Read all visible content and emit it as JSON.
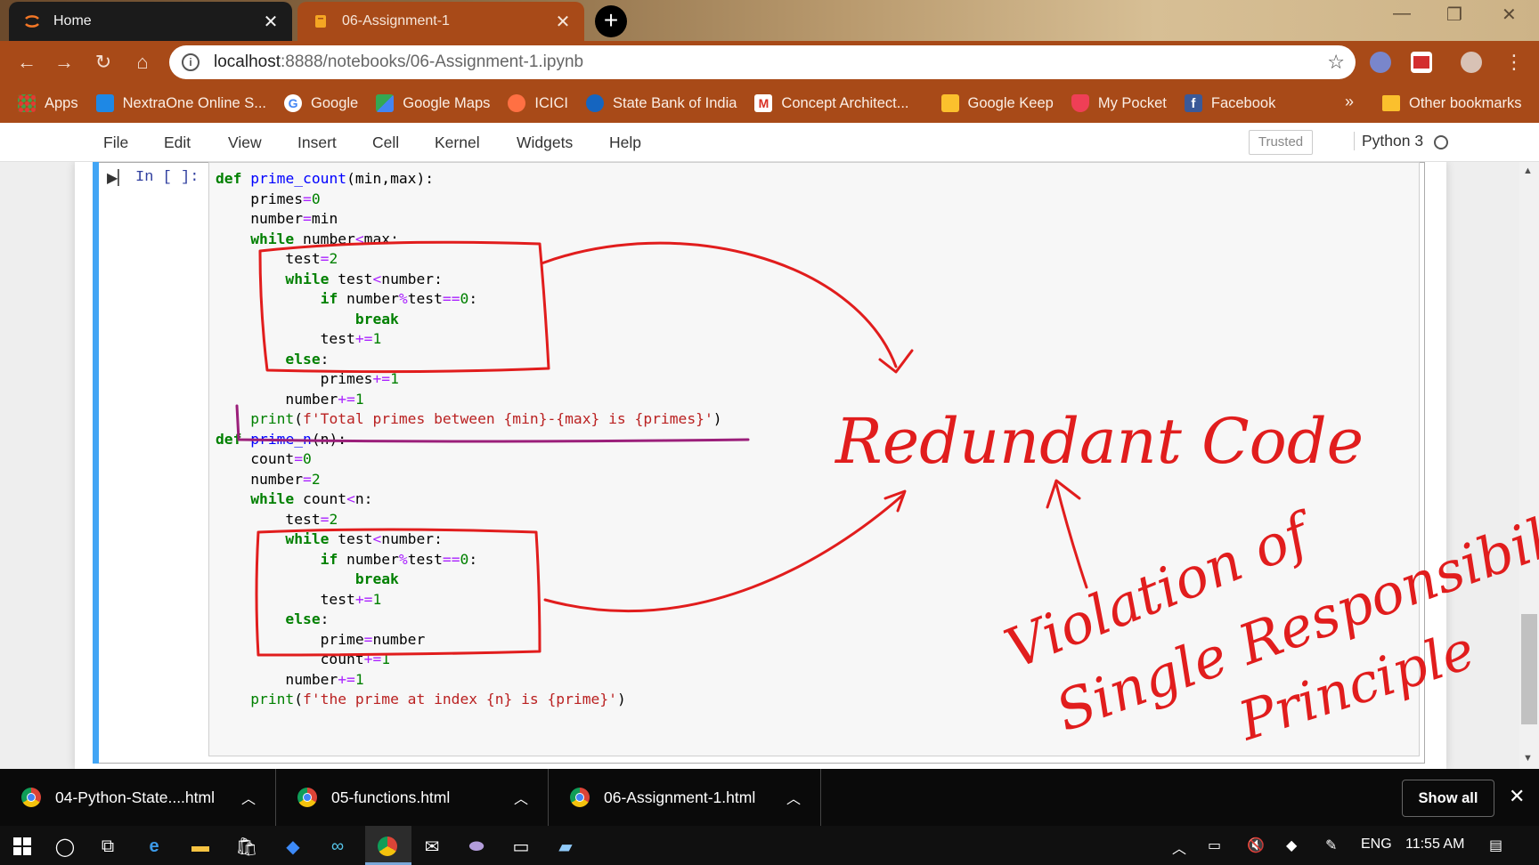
{
  "browser": {
    "tabs": [
      {
        "title": "Home"
      },
      {
        "title": "06-Assignment-1"
      }
    ],
    "url_host": "localhost",
    "url_path": ":8888/notebooks/06-Assignment-1.ipynb",
    "bookmarks": [
      {
        "label": "Apps",
        "icon": "apps-grid-icon",
        "color": "#e53935"
      },
      {
        "label": "NextraOne Online S...",
        "icon": "nextraone-icon",
        "color": "#1e88e5"
      },
      {
        "label": "Google",
        "icon": "google-icon",
        "color": "#ffffff"
      },
      {
        "label": "Google Maps",
        "icon": "google-maps-icon",
        "color": "#34a853"
      },
      {
        "label": "ICICI",
        "icon": "icici-icon",
        "color": "#ff7043"
      },
      {
        "label": "State Bank of India",
        "icon": "sbi-icon",
        "color": "#1565c0"
      },
      {
        "label": "Concept Architect...",
        "icon": "gmail-icon",
        "color": "#ffffff"
      },
      {
        "label": "Google Keep",
        "icon": "google-keep-icon",
        "color": "#fbc02d"
      },
      {
        "label": "My Pocket",
        "icon": "pocket-icon",
        "color": "#ef3f56"
      },
      {
        "label": "Facebook",
        "icon": "facebook-icon",
        "color": "#3b5998"
      }
    ],
    "bookmarks_more": "»",
    "other_bookmarks": "Other bookmarks"
  },
  "jupyter": {
    "menu": [
      "File",
      "Edit",
      "View",
      "Insert",
      "Cell",
      "Kernel",
      "Widgets",
      "Help"
    ],
    "trusted": "Trusted",
    "kernel": "Python 3"
  },
  "cell": {
    "prompt": "In [ ]:",
    "code_lines": [
      "def prime_count(min,max):",
      "    primes=0",
      "    number=min",
      "    while number<max:",
      "        test=2",
      "        while test<number:",
      "            if number%test==0:",
      "                break",
      "            test+=1",
      "        else:",
      "            primes+=1",
      "        number+=1",
      "    print(f'Total primes between {min}-{max} is {primes}')",
      "def prime_n(n):",
      "    count=0",
      "    number=2",
      "    while count<n:",
      "        test=2",
      "        while test<number:",
      "            if number%test==0:",
      "                break",
      "            test+=1",
      "        else:",
      "            prime=number",
      "            count+=1",
      "        number+=1",
      "    print(f'the prime at index {n} is {prime}')"
    ]
  },
  "annotations": {
    "redundant": "Redundant Code",
    "violation_line1": "Violation of",
    "violation_line2": "Single Responsibility",
    "violation_line3": "Principle",
    "ink_color": "#e11d1d",
    "underline_color": "#9b1f7a"
  },
  "downloads": [
    {
      "name": "04-Python-State....html"
    },
    {
      "name": "05-functions.html"
    },
    {
      "name": "06-Assignment-1.html"
    }
  ],
  "downloads_show_all": "Show all",
  "taskbar": {
    "language": "ENG",
    "time": "11:55 AM"
  }
}
